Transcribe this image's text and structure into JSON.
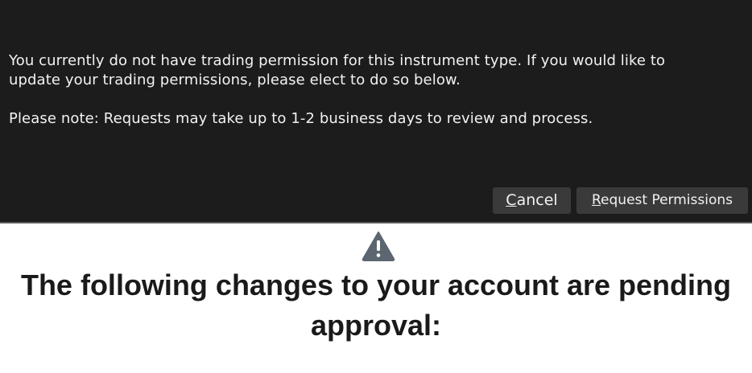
{
  "dialog": {
    "message": "You currently do not have trading permission for this instrument type. If you would like to\nupdate your trading permissions, please elect to do so below.",
    "note": "Please note: Requests may take up to 1-2 business days to review and process.",
    "buttons": {
      "cancel": {
        "mnemonic": "C",
        "rest": "ancel"
      },
      "request": {
        "mnemonic": "R",
        "rest": "equest Permissions"
      }
    }
  },
  "page": {
    "icon": "warning-triangle-icon",
    "heading": "The following changes to your account are pending approval:"
  },
  "colors": {
    "dialog_background": "#1c1c1c",
    "button_background": "#3a3a3a",
    "dialog_text": "#f2f2f2",
    "heading_text": "#1a1a1a",
    "icon_fill": "#5c6670"
  }
}
